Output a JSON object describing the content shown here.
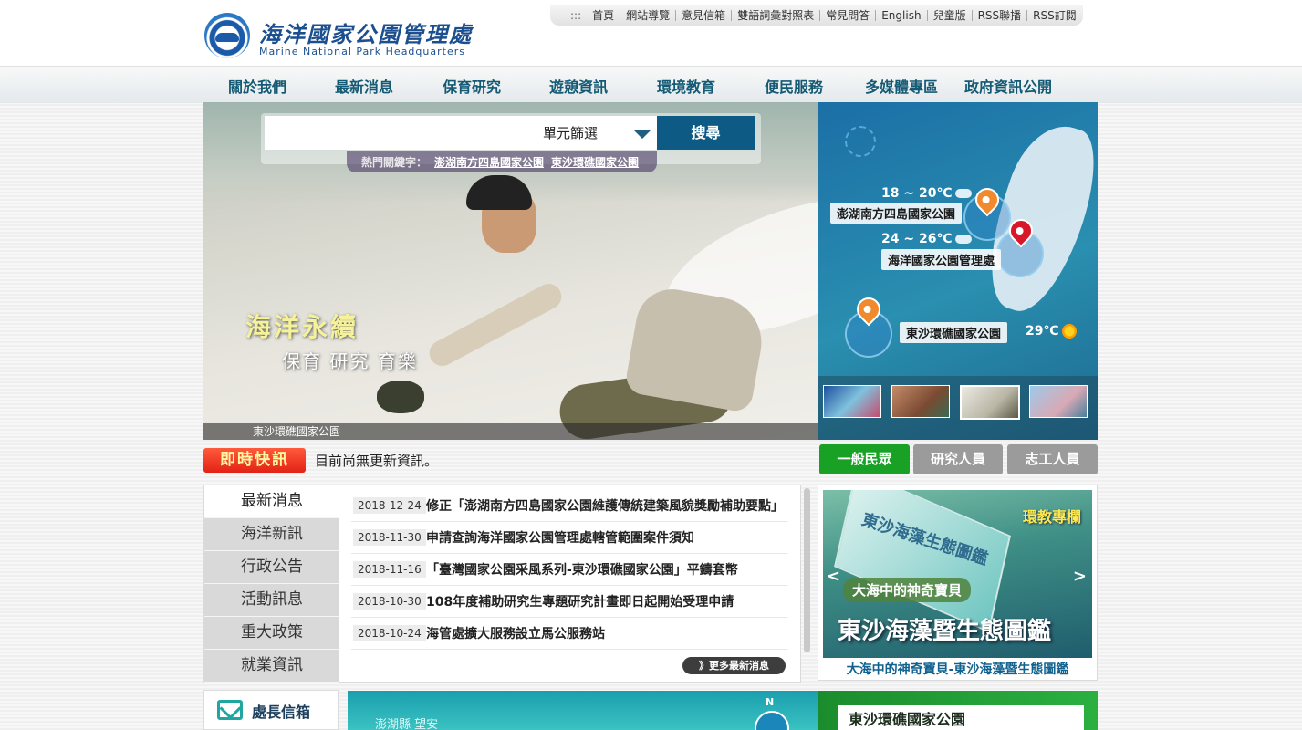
{
  "header": {
    "logo_cn": "海洋國家公園管理處",
    "logo_en": "Marine National Park Headquarters",
    "util_links": [
      "首頁",
      "網站導覽",
      "意見信箱",
      "雙語詞彙對照表",
      "常見問答",
      "English",
      "兒童版",
      "RSS聯播",
      "RSS訂閱"
    ],
    "util_prefix": ":::"
  },
  "nav": [
    "關於我們",
    "最新消息",
    "保育研究",
    "遊憩資訊",
    "環境教育",
    "便民服務",
    "多媒體專區",
    "政府資訊公開"
  ],
  "search": {
    "placeholder": "",
    "filter_label": "單元篩選",
    "button": "搜尋",
    "hot_label": "熱門關鍵字：",
    "hot_keywords": [
      "澎湖南方四島國家公園",
      "東沙環礁國家公園"
    ]
  },
  "banner": {
    "slogan_main": "海洋永續",
    "slogan_sub": "保育  研究  育樂",
    "caption": "東沙環礁國家公園"
  },
  "map": {
    "locations": [
      {
        "temp": "18 ~ 20℃",
        "name": "澎湖南方四島國家公園",
        "weather": "cloud-icon"
      },
      {
        "temp": "24 ~ 26℃",
        "name": "海洋國家公園管理處",
        "weather": "cloud-icon"
      },
      {
        "temp": "29℃",
        "name": "東沙環礁國家公園",
        "weather": "sun-icon"
      }
    ]
  },
  "instant": {
    "label": "即時快訊",
    "text": "目前尚無更新資訊。"
  },
  "audience_tabs": [
    {
      "label": "一般民眾",
      "color": "#18a125"
    },
    {
      "label": "研究人員",
      "color": "#9b9b9b"
    },
    {
      "label": "志工人員",
      "color": "#9b9b9b"
    }
  ],
  "news": {
    "tabs": [
      "最新消息",
      "海洋新訊",
      "行政公告",
      "活動訊息",
      "重大政策",
      "就業資訊"
    ],
    "items": [
      {
        "date": "2018-12-24",
        "title": "修正「澎湖南方四島國家公園維護傳統建築風貌獎勵補助要點」"
      },
      {
        "date": "2018-11-30",
        "title": "申請查詢海洋國家公園管理處轄管範圍案件須知"
      },
      {
        "date": "2018-11-16",
        "title": "「臺灣國家公園采風系列-東沙環礁國家公園」平鑄套幣"
      },
      {
        "date": "2018-10-30",
        "title": "108年度補助研究生專題研究計畫即日起開始受理申請"
      },
      {
        "date": "2018-10-24",
        "title": "海管處擴大服務設立馬公服務站"
      }
    ],
    "more": "》更多最新消息"
  },
  "promo": {
    "tag": "環教專欄",
    "book_title": "東沙海藻生態圖鑑",
    "sub": "大海中的神奇寶貝",
    "main": "東沙海藻暨生態圖鑑",
    "caption": "大海中的神奇寶貝-東沙海藻暨生態圖鑑",
    "prev": "<",
    "next": ">"
  },
  "bottom": {
    "mailbox": "處長信箱",
    "map_label": "澎湖縣 望安",
    "north": "N",
    "park_label": "東沙環礁國家公園"
  }
}
